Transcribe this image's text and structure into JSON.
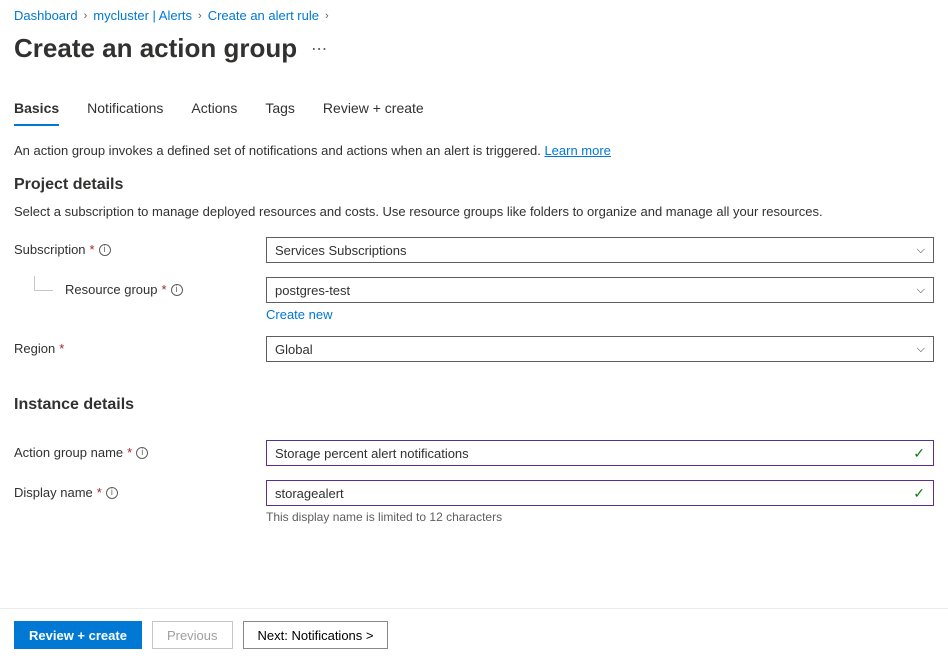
{
  "breadcrumb": {
    "items": [
      "Dashboard",
      "mycluster | Alerts",
      "Create an alert rule"
    ]
  },
  "page_title": "Create an action group",
  "tabs": [
    "Basics",
    "Notifications",
    "Actions",
    "Tags",
    "Review + create"
  ],
  "intro": {
    "text": "An action group invokes a defined set of notifications and actions when an alert is triggered. ",
    "link": "Learn more"
  },
  "project_details": {
    "heading": "Project details",
    "description": "Select a subscription to manage deployed resources and costs. Use resource groups like folders to organize and manage all your resources.",
    "subscription_label": "Subscription",
    "subscription_value": "Services Subscriptions",
    "resource_group_label": "Resource group",
    "resource_group_value": "postgres-test",
    "create_new": "Create new",
    "region_label": "Region",
    "region_value": "Global"
  },
  "instance_details": {
    "heading": "Instance details",
    "action_group_name_label": "Action group name",
    "action_group_name_value": "Storage percent alert notifications",
    "display_name_label": "Display name",
    "display_name_value": "storagealert",
    "display_name_helper": "This display name is limited to 12 characters"
  },
  "footer": {
    "review": "Review + create",
    "previous": "Previous",
    "next": "Next: Notifications >"
  }
}
